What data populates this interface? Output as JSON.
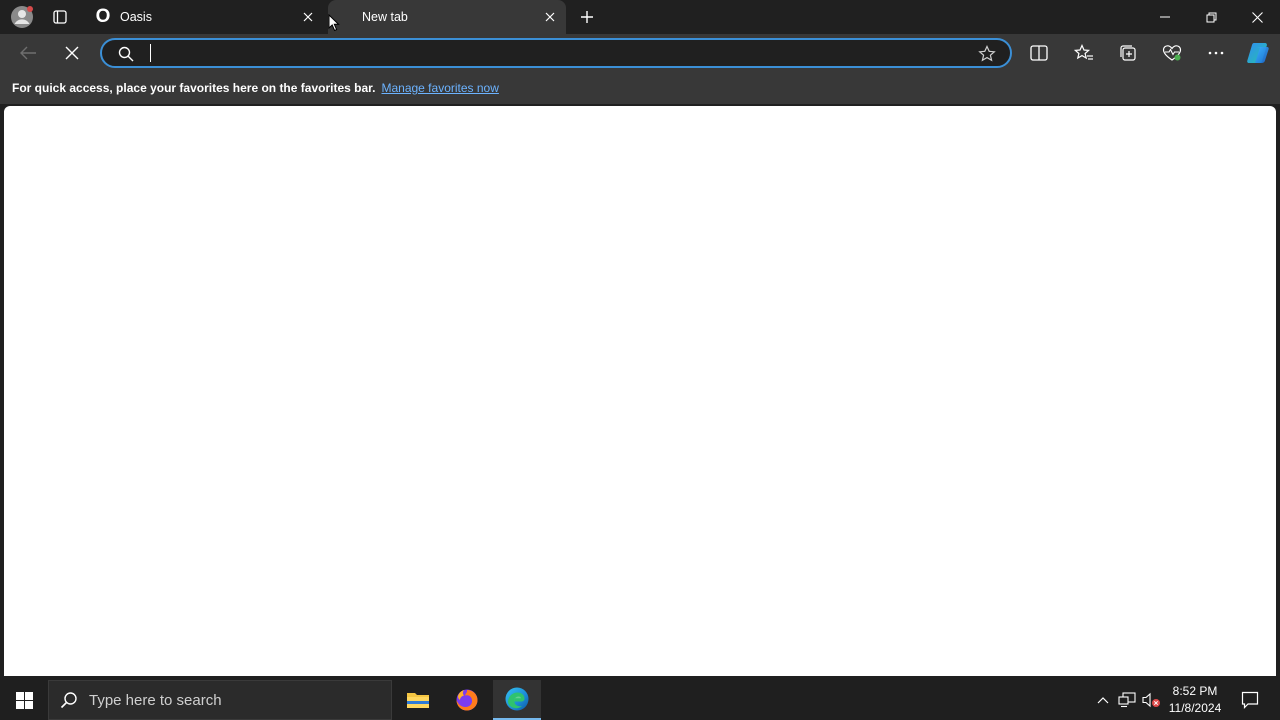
{
  "tabs": [
    {
      "title": "Oasis",
      "favicon": "O",
      "active": false
    },
    {
      "title": "New tab",
      "active": true
    }
  ],
  "address": {
    "value": "",
    "placeholder": ""
  },
  "favbar": {
    "message": "For quick access, place your favorites here on the favorites bar.",
    "link": "Manage favorites now"
  },
  "taskbar": {
    "search_placeholder": "Type here to search",
    "time": "8:52 PM",
    "date": "11/8/2024"
  },
  "icons": {
    "profile": "profile-avatar-icon",
    "tab_actions": "tab-actions-icon",
    "close": "close-icon",
    "new_tab": "plus-icon",
    "minimize": "minimize-icon",
    "restore": "restore-icon",
    "back": "back-arrow-icon",
    "stop": "stop-loading-icon",
    "search": "search-icon",
    "favorite": "star-icon",
    "split_screen": "split-screen-icon",
    "favorites": "favorites-icon",
    "collections": "collections-icon",
    "browser_essentials": "heart-pulse-icon",
    "more": "ellipsis-icon",
    "copilot": "copilot-icon"
  },
  "colors": {
    "chrome": "#202020",
    "toolbar": "#383838",
    "accent": "#3b8fd6",
    "link": "#6cb3ff"
  }
}
